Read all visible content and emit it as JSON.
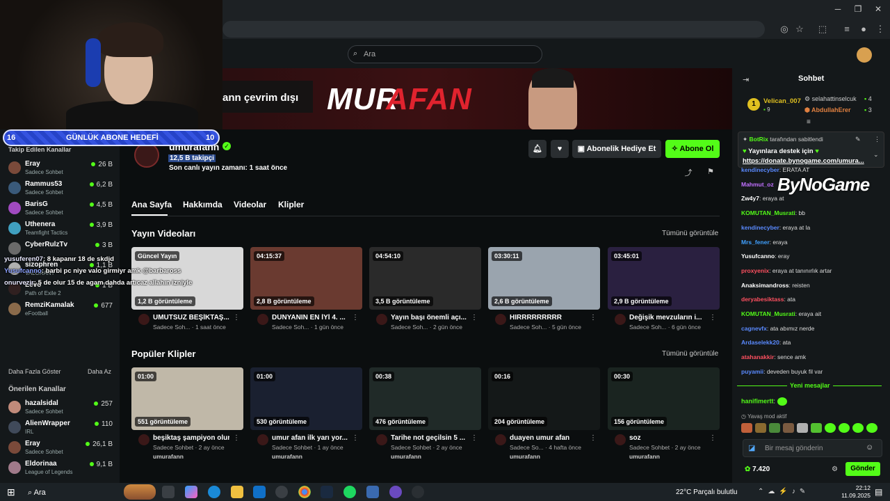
{
  "browser": {
    "win_min": "─",
    "win_max": "❐",
    "win_close": "✕"
  },
  "header": {
    "search_placeholder": "Ara"
  },
  "banner": {
    "offline": "ann çevrim dışı",
    "name_part1": "MUR",
    "name_part2": "AFAN"
  },
  "goal": {
    "left": "16",
    "title": "GÜNLÜK ABONE HEDEFİ",
    "right": "10"
  },
  "sidebar": {
    "followed_heading": "Takip Edilen Kanallar",
    "followed": [
      {
        "name": "Eray",
        "game": "Sadece Sohbet",
        "count": "26 B",
        "color": "#7a4a3a"
      },
      {
        "name": "Rammus53",
        "game": "Sadece Sohbet",
        "count": "6,2 B",
        "color": "#3a5a7a"
      },
      {
        "name": "BarisG",
        "game": "Sadece Sohbet",
        "count": "4,5 B",
        "color": "#a04ac0"
      },
      {
        "name": "Uthenera",
        "game": "Teamfight Tactics",
        "count": "3,9 B",
        "color": "#40a0c0"
      },
      {
        "name": "CyberRulzTv",
        "game": "",
        "count": "3 B",
        "color": "#6a6a6a"
      },
      {
        "name": "sizophren",
        "game": "VALORANT",
        "count": "1,1 B",
        "color": "#b0b0b0"
      },
      {
        "name": "Levo",
        "game": "Path of Exile 2",
        "count": "1 B",
        "color": "#302020"
      },
      {
        "name": "RemziKamalak",
        "game": "eFootball",
        "count": "677",
        "color": "#8a6a4a"
      }
    ],
    "show_more": "Daha Fazla Göster",
    "show_less": "Daha Az",
    "recommended_heading": "Önerilen Kanallar",
    "recommended": [
      {
        "name": "hazalsidal",
        "game": "Sadece Sohbet",
        "count": "257",
        "color": "#c08a7a"
      },
      {
        "name": "AlienWrapper",
        "game": "IRL",
        "count": "110",
        "color": "#404a5a"
      },
      {
        "name": "Eray",
        "game": "Sadece Sohbet",
        "count": "26,1 B",
        "color": "#7a4a3a"
      },
      {
        "name": "Eldorinaa",
        "game": "League of Legends",
        "count": "9,1 B",
        "color": "#a07a8a"
      }
    ]
  },
  "overlay_chat": [
    {
      "user": "yusuferen07",
      "text": ": 8 kapanır 18 de skdjd"
    },
    {
      "user": "Yusufcanno",
      "text": ": barbi pc niye valo girmiyr amk @barbaross"
    },
    {
      "user": "onurvezir",
      "text": ": 5 de olur 15 de agam dahda artıcaz allahın izniyle"
    }
  ],
  "channel": {
    "name": "umurafann",
    "followers": "12,5 B takipçi",
    "last_live": "Son canlı yayın zamanı: 1 saat önce",
    "gift_btn": "Abonelik Hediye Et",
    "sub_btn": "Abone Ol"
  },
  "tabs": [
    "Ana Sayfa",
    "Hakkımda",
    "Videolar",
    "Klipler"
  ],
  "videos_section": {
    "title": "Yayın Videoları",
    "see_all": "Tümünü görüntüle"
  },
  "videos": [
    {
      "badge": "Güncel Yayın",
      "views": "1,2 B görüntüleme",
      "title": "UMUTSUZ BEŞİKTAŞ...",
      "meta": "Sadece Soh... · 1 saat önce",
      "bg": "#d8d8d8"
    },
    {
      "badge": "04:15:37",
      "views": "2,8 B görüntüleme",
      "title": "DÜNYANIN EN İYİ 4. ...",
      "meta": "Sadece Soh... · 1 gün önce",
      "bg": "#6a3a30"
    },
    {
      "badge": "04:54:10",
      "views": "3,5 B görüntüleme",
      "title": "Yayın başı önemli açı...",
      "meta": "Sadece Soh... · 2 gün önce",
      "bg": "#2a2a2a"
    },
    {
      "badge": "03:30:11",
      "views": "2,6 B görüntüleme",
      "title": "HIRRRRRRRRR",
      "meta": "Sadece Soh... · 5 gün önce",
      "bg": "#9aa4ae"
    },
    {
      "badge": "03:45:01",
      "views": "2,9 B görüntüleme",
      "title": "Değişik mevzuların i...",
      "meta": "Sadece Soh... · 6 gün önce",
      "bg": "#2a2040"
    }
  ],
  "clips_section": {
    "title": "Popüler Klipler",
    "see_all": "Tümünü görüntüle"
  },
  "clips": [
    {
      "badge": "01:00",
      "views": "551 görüntüleme",
      "title": "beşiktaş şampiyon olur",
      "meta": "Sadece Sohbet · 2 ay önce",
      "author": "umurafann",
      "bg": "#c0b8a8"
    },
    {
      "badge": "01:00",
      "views": "530 görüntüleme",
      "title": "umur afan ilk yarı yor...",
      "meta": "Sadece Sohbet · 1 ay önce",
      "author": "umurafann",
      "bg": "#1a2030"
    },
    {
      "badge": "00:38",
      "views": "476 görüntüleme",
      "title": "Tarihe not geçilsin 5 ...",
      "meta": "Sadece Sohbet · 2 ay önce",
      "author": "umurafann",
      "bg": "#202a28"
    },
    {
      "badge": "00:16",
      "views": "204 görüntüleme",
      "title": "duayen umur afan",
      "meta": "Sadece So... · 4 hafta önce",
      "author": "umurafann",
      "bg": "#141818"
    },
    {
      "badge": "00:30",
      "views": "156 görüntüleme",
      "title": "soz",
      "meta": "Sadece Sohbet · 2 ay önce",
      "author": "umurafann",
      "bg": "#1a2420"
    }
  ],
  "chat": {
    "title": "Sohbet",
    "top_gifters": [
      {
        "name": "Velican_007",
        "count": "9",
        "color": "#e0c020"
      },
      {
        "name": "selahattinselcuk",
        "count": "4",
        "color": "#ccc"
      },
      {
        "name": "AbdullahErer",
        "count": "3",
        "color": "#e08040"
      }
    ],
    "pinned_by": "BotRix",
    "pinned_by_suffix": "tarafından sabitlendi",
    "pinned_text": "Yayınlara destek için",
    "pinned_link": "https://donate.bynogame.com/umura...",
    "brand": "ByNoGame",
    "messages": [
      {
        "user": "kendinecyber",
        "text": ": ERATA AT",
        "color": "#5a8aff"
      },
      {
        "user": "Mahmut_oz",
        "text": "",
        "color": "#c070ff"
      },
      {
        "user": "Zw4y7",
        "text": ": eraya at",
        "color": "#fff"
      },
      {
        "user": "KOMUTAN_Musrati",
        "text": ": bb",
        "color": "#53fc18"
      },
      {
        "user": "kendinecyber",
        "text": ": eraya at la",
        "color": "#5a8aff"
      },
      {
        "user": "Mrs_fener",
        "text": ": eraya",
        "color": "#40a0ff"
      },
      {
        "user": "Yusufcanno",
        "text": ": eray",
        "color": "#fff"
      },
      {
        "user": "proxyenix",
        "text": ": eraya at tanınırlık artar",
        "color": "#ff5060"
      },
      {
        "user": "Anaksimandross",
        "text": ": reisten",
        "color": "#fff"
      },
      {
        "user": "deryabesiktass",
        "text": ": ata",
        "color": "#ff5060"
      },
      {
        "user": "KOMUTAN_Musrati",
        "text": ": eraya ait",
        "color": "#53fc18"
      },
      {
        "user": "cagnevfx",
        "text": ": ata abımız nerde",
        "color": "#5a8aff"
      },
      {
        "user": "Ardaselekk20",
        "text": ": ata",
        "color": "#5a8aff"
      },
      {
        "user": "atahanakkir",
        "text": ": sence amk",
        "color": "#ff5060"
      },
      {
        "user": "puyamii",
        "text": ": deveden buyuk fil var",
        "color": "#5a8aff"
      }
    ],
    "new_messages": "Yeni mesajlar",
    "latest_user": "hanifimertt",
    "slow_mode": "Yavaş mod aktif",
    "input_placeholder": "Bir mesaj gönderin",
    "points": "7.420",
    "send": "Gönder"
  },
  "taskbar": {
    "search": "Ara",
    "weather": "22°C  Parçalı bulutlu",
    "time": "22:12",
    "date": "11.09.2025"
  }
}
